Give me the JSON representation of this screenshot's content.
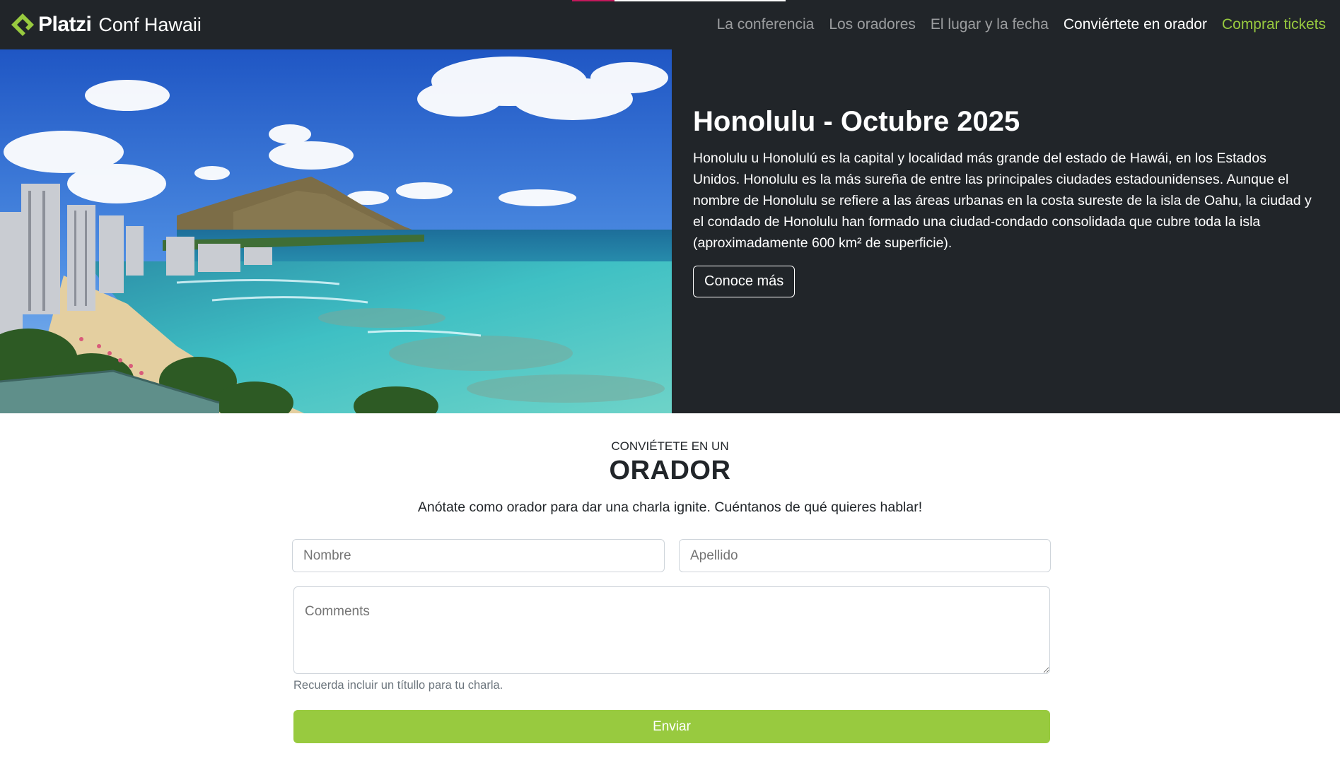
{
  "navbar": {
    "brand_name": "Platzi",
    "brand_sub": "Conf Hawaii",
    "links": [
      "La conferencia",
      "Los oradores",
      "El lugar y la fecha",
      "Conviértete en orador",
      "Comprar tickets"
    ]
  },
  "hero": {
    "title": "Honolulu - Octubre 2025",
    "description": "Honolulu u Honolulú es la capital y localidad más grande del estado de Hawái, en los Estados Unidos. Honolulu es la más sureña de entre las principales ciudades estadounidenses. Aunque el nombre de Honolulu se refiere a las áreas urbanas en la costa sureste de la isla de Oahu, la ciudad y el condado de Honolulu han formado una ciudad-condado consolidada que cubre toda la isla (aproximadamente 600 km² de superficie).",
    "button_label": "Conoce más"
  },
  "speaker_section": {
    "kicker": "CONVIÉTETE EN UN",
    "title": "ORADOR",
    "subtitle": "Anótate como orador para dar una charla ignite. Cuéntanos de qué quieres hablar!",
    "form": {
      "first_name_placeholder": "Nombre",
      "last_name_placeholder": "Apellido",
      "comments_placeholder": "Comments",
      "help_text": "Recuerda incluir un títullo para tu charla.",
      "submit_label": "Enviar"
    }
  },
  "colors": {
    "navbar_bg": "#212529",
    "accent_green": "#98ca3f",
    "top_strip_pink": "#c2185b",
    "top_strip_white": "#ffffff"
  },
  "icons": {
    "brand": "platzi-logo-icon"
  }
}
